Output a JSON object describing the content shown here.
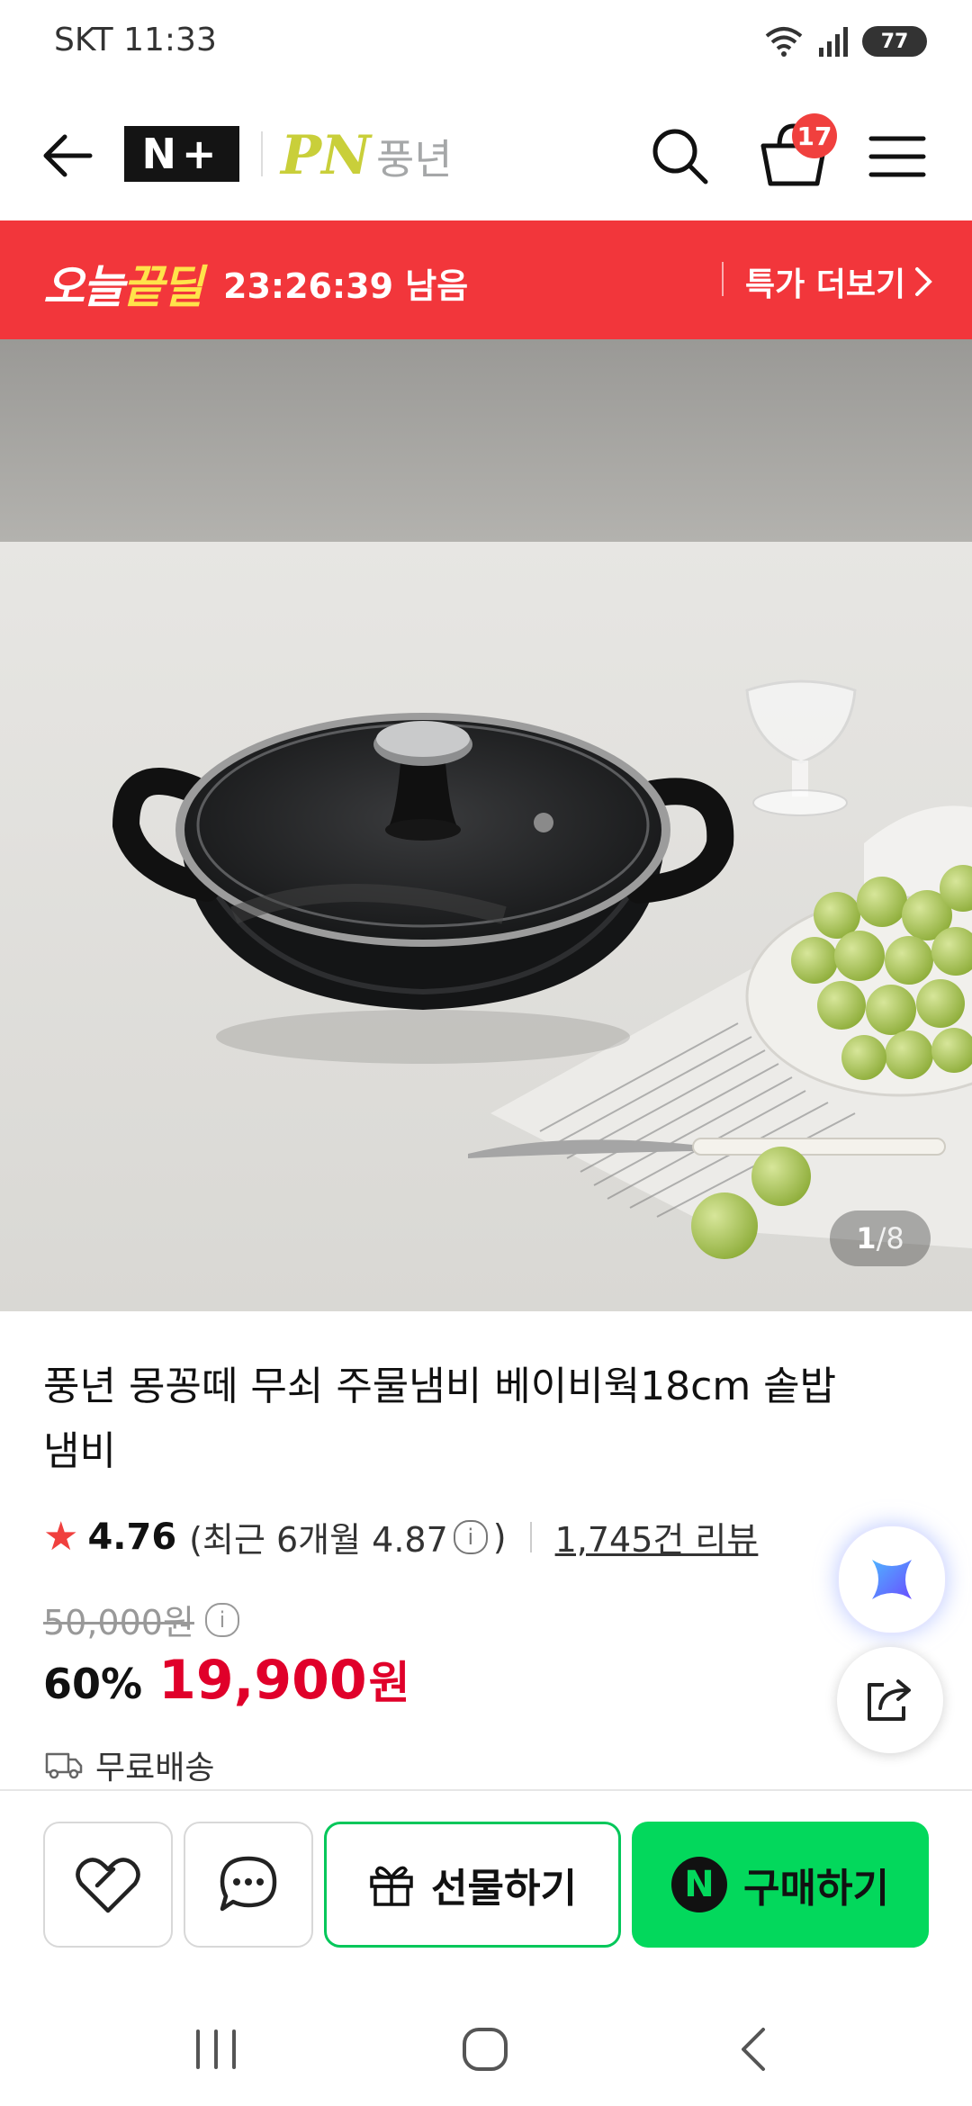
{
  "status_bar": {
    "carrier_time": "SKT 11:33",
    "battery": "77"
  },
  "header": {
    "brand_nplus": "N+",
    "brand_logo_latin": "PN",
    "brand_logo_korean": "풍년",
    "cart_count": "17"
  },
  "deal_banner": {
    "title_part1": "오늘",
    "title_part2": "끝딜",
    "timer": "23:26:39 남음",
    "more_label": "특가 더보기"
  },
  "gallery": {
    "current": "1",
    "separator": "/",
    "total": "8"
  },
  "product": {
    "title": "풍년 몽꽁떼 무쇠 주물냄비 베이비웍18cm 솥밥 냄비",
    "rating": "4.76",
    "recent_rating_text": "(최근 6개월 4.87",
    "recent_rating_close": ")",
    "review_count": "1,745건 리뷰",
    "original_price": "50,000원",
    "discount": "60%",
    "sale_price": "19,900",
    "currency": "원",
    "shipping": "무료배송"
  },
  "action_bar": {
    "gift_label": "선물하기",
    "buy_label": "구매하기",
    "buy_badge": "N"
  },
  "colors": {
    "deal_red": "#f2363b",
    "price_red": "#e0002a",
    "naver_green": "#03d85c",
    "badge_red": "#f0403e"
  }
}
